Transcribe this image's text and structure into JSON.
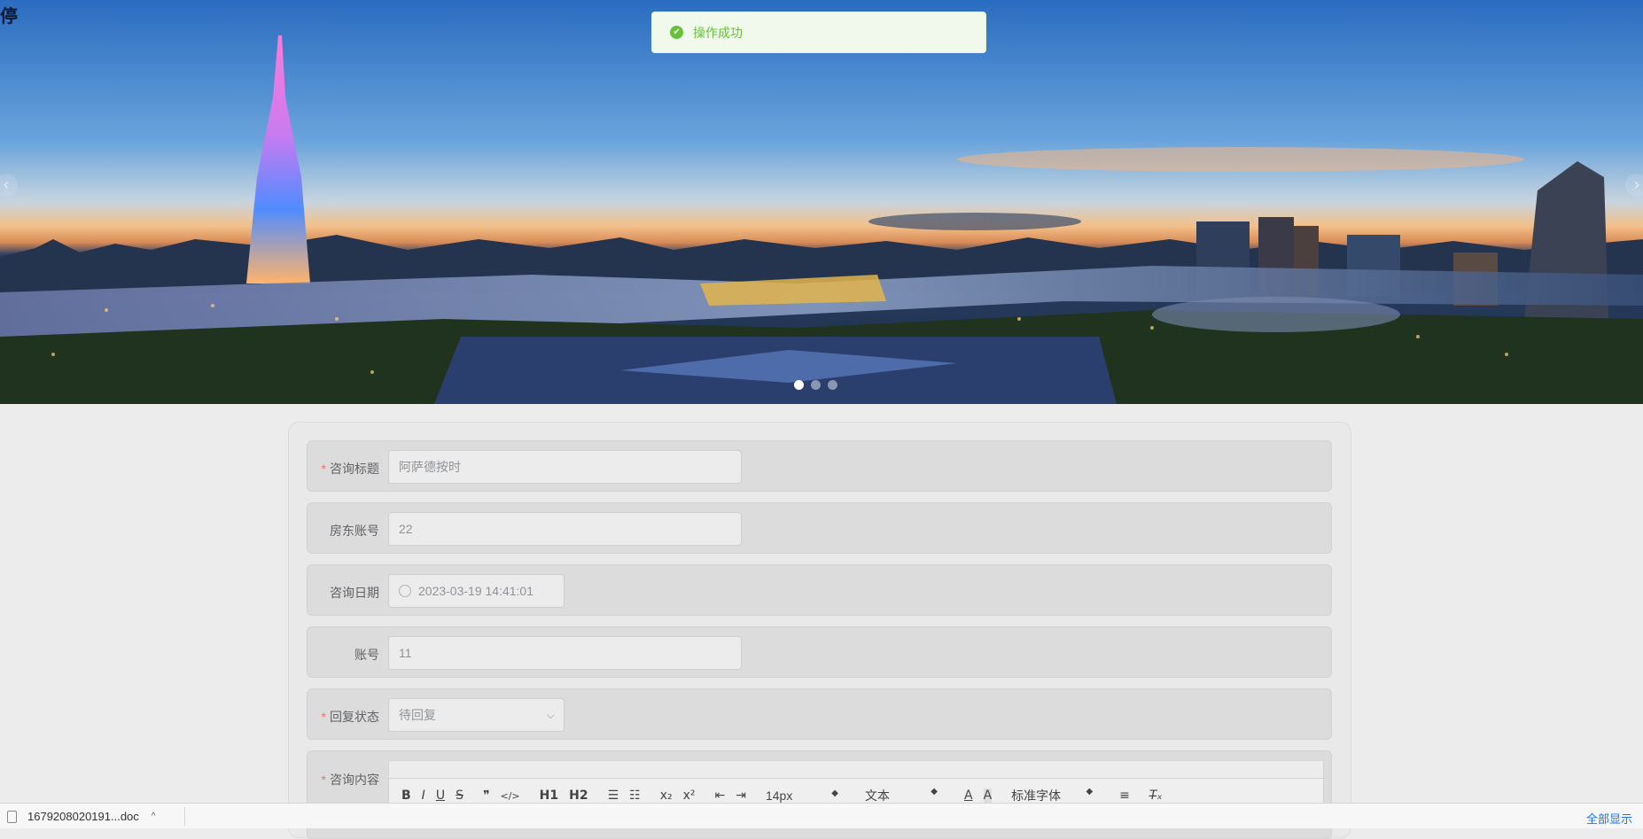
{
  "banner": {
    "corner_text": "停",
    "dots": [
      true,
      false,
      false
    ]
  },
  "toast": {
    "message": "操作成功"
  },
  "form": {
    "fields": [
      {
        "label": "咨询标题",
        "required": true,
        "value": "阿萨德按时"
      },
      {
        "label": "房东账号",
        "required": false,
        "value": "22"
      },
      {
        "label": "咨询日期",
        "required": false,
        "value": "2023-03-19 14:41:01"
      },
      {
        "label": "账号",
        "required": false,
        "value": "11"
      },
      {
        "label": "回复状态",
        "required": true,
        "value": "待回复"
      },
      {
        "label": "咨询内容",
        "required": true,
        "value": ""
      }
    ]
  },
  "editor": {
    "font_size": "14px",
    "text_type": "文本",
    "font_family": "标准字体",
    "tools": [
      "B",
      "I",
      "U",
      "S",
      "❞",
      "</>",
      "H1",
      "H2",
      "ordered-list",
      "bullet-list",
      "x₂",
      "x²",
      "outdent",
      "indent",
      "text-color",
      "background-color",
      "align",
      "clear-format"
    ]
  },
  "download_bar": {
    "filename": "1679208020191...doc",
    "show_all": "全部显示"
  },
  "colors": {
    "success": "#67c23a",
    "required": "#f56c6c",
    "link": "#1a73e8"
  }
}
